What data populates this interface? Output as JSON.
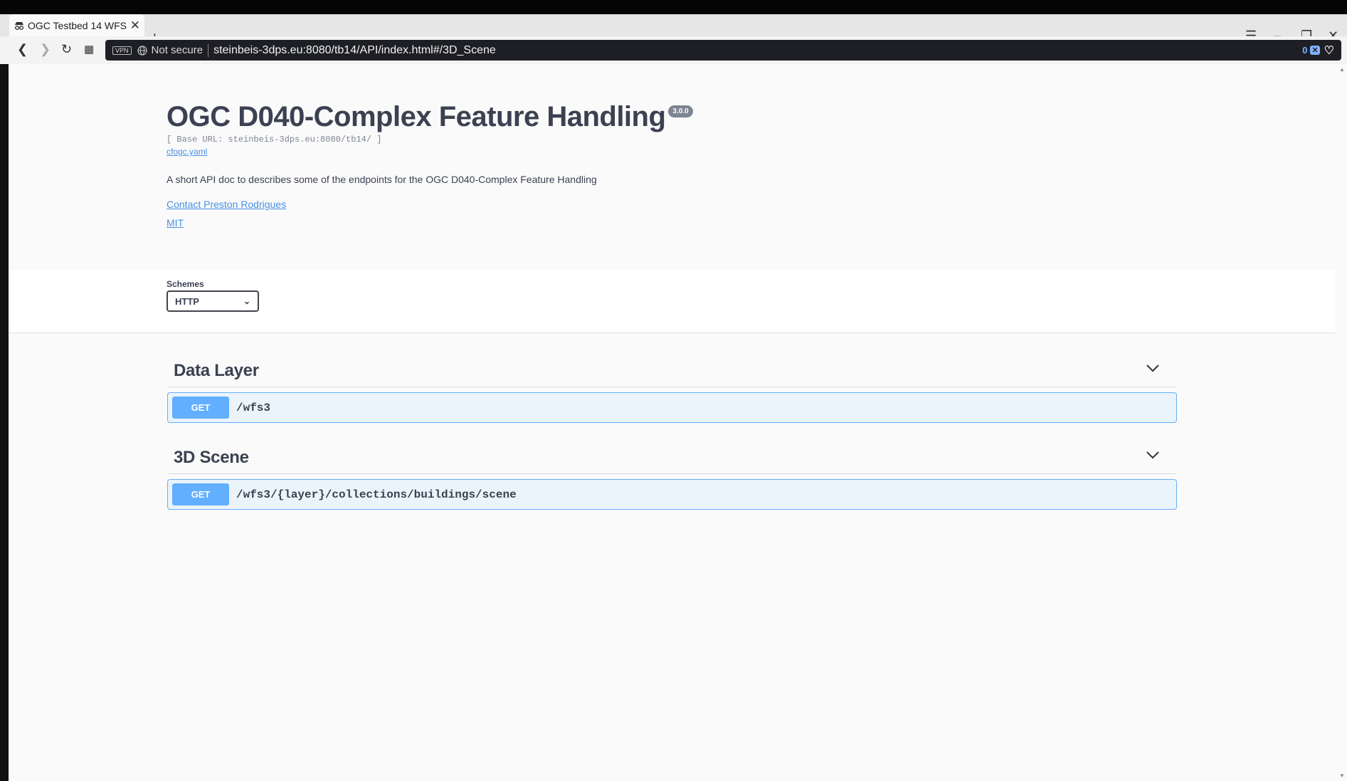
{
  "browser": {
    "tab_title": "OGC Testbed 14 WFS",
    "vpn_label": "VPN",
    "security_label": "Not secure",
    "url": "steinbeis-3dps.eu:8080/tb14/API/index.html#/3D_Scene",
    "shield_count": "0",
    "accent_color": "#61affe"
  },
  "api": {
    "title": "OGC D040-Complex Feature Handling",
    "version": "3.0.0",
    "base_url": "[ Base URL: steinbeis-3dps.eu:8080/tb14/ ]",
    "spec_link": "cfogc.yaml",
    "description": "A short API doc to describes some of the endpoints for the OGC D040-Complex Feature Handling",
    "contact_link": "Contact Preston Rodrigues",
    "license_link": "MIT"
  },
  "schemes": {
    "label": "Schemes",
    "selected": "HTTP"
  },
  "sections": [
    {
      "title": "Data Layer",
      "operations": [
        {
          "method": "GET",
          "path": "/wfs3"
        }
      ]
    },
    {
      "title": "3D Scene",
      "operations": [
        {
          "method": "GET",
          "path": "/wfs3/{layer}/collections/buildings/scene"
        }
      ]
    }
  ]
}
